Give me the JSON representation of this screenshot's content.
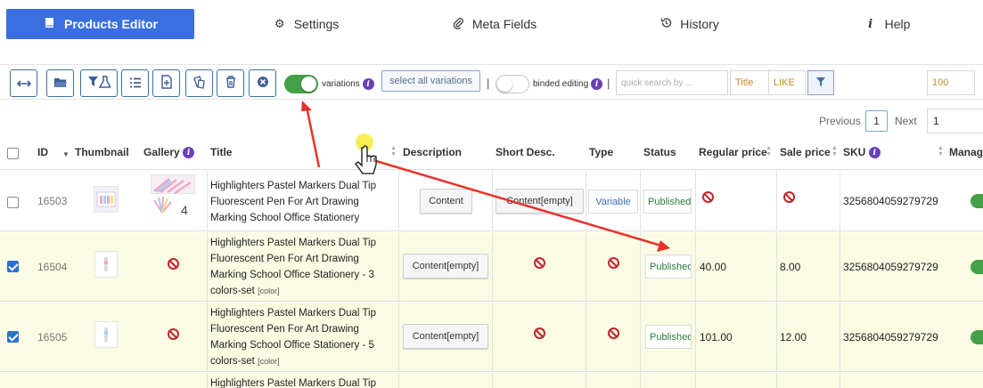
{
  "tabs": [
    {
      "label": "Products Editor",
      "icon": "book-icon",
      "active": true
    },
    {
      "label": "Settings",
      "icon": "gear-icon"
    },
    {
      "label": "Meta Fields",
      "icon": "paperclip-icon"
    },
    {
      "label": "History",
      "icon": "history-icon"
    },
    {
      "label": "Help",
      "icon": "info-icon"
    }
  ],
  "toolbar": {
    "buttons": [
      {
        "name": "resize-columns-button",
        "icon": "arrows-horizontal-icon"
      },
      {
        "name": "open-folder-button",
        "icon": "folder-icon"
      },
      {
        "name": "filter-lab-button",
        "icon": "filter-flask-icon"
      },
      {
        "name": "list-button",
        "icon": "list-icon"
      },
      {
        "name": "add-product-button",
        "icon": "file-plus-icon"
      },
      {
        "name": "duplicate-button",
        "icon": "copy-icon"
      },
      {
        "name": "delete-button",
        "icon": "trash-icon"
      },
      {
        "name": "cancel-button",
        "icon": "close-circle-icon"
      }
    ],
    "variations_label": "variations",
    "variations_on": true,
    "select_all_variations": "select all variations",
    "separator": "|",
    "binded_editing_label": "binded editing",
    "binded_editing_on": false,
    "search_placeholder": "quick search by ...",
    "search_field": "Title",
    "search_operator": "LIKE",
    "per_page": "100"
  },
  "pager": {
    "previous": "Previous",
    "current": "1",
    "next": "Next",
    "goto": "1"
  },
  "columns": [
    "ID",
    "Thumbnail",
    "Gallery",
    "Title",
    "Description",
    "Short Desc.",
    "Type",
    "Status",
    "Regular price",
    "Sale price",
    "SKU",
    "Manag"
  ],
  "rows": [
    {
      "id": "16503",
      "checked": false,
      "title": "Highlighters Pastel Markers Dual Tip Fluorescent Pen For Art Drawing Marking School Office Stationery",
      "tag": "",
      "gallery_count": "4",
      "description": "Content",
      "short_desc": "Content[empty]",
      "type": "Variable",
      "status": "Published",
      "regular_price": "",
      "sale_price": "",
      "sku": "3256804059279729"
    },
    {
      "id": "16504",
      "checked": true,
      "title": "Highlighters Pastel Markers Dual Tip Fluorescent Pen For Art Drawing Marking School Office Stationery - 3 colors-set",
      "tag": "[color]",
      "gallery_count": "",
      "description": "Content[empty]",
      "short_desc": "",
      "type": "",
      "status": "Published",
      "regular_price": "40.00",
      "sale_price": "8.00",
      "sku": "3256804059279729"
    },
    {
      "id": "16505",
      "checked": true,
      "title": "Highlighters Pastel Markers Dual Tip Fluorescent Pen For Art Drawing Marking School Office Stationery - 5 colors-set",
      "tag": "[color]",
      "gallery_count": "",
      "description": "Content[empty]",
      "short_desc": "",
      "type": "",
      "status": "Published",
      "regular_price": "101.00",
      "sale_price": "12.00",
      "sku": "3256804059279729"
    },
    {
      "id": "",
      "checked": false,
      "title": "Highlighters Pastel Markers Dual Tip",
      "tag": "",
      "gallery_count": "",
      "description": "",
      "short_desc": "",
      "type": "",
      "status": "",
      "regular_price": "",
      "sale_price": "",
      "sku": ""
    }
  ],
  "colors": {
    "accent": "#3b6fe0",
    "toggle_on": "#43a047",
    "arrow": "#e8322b",
    "selected_row": "#fafbe3"
  }
}
